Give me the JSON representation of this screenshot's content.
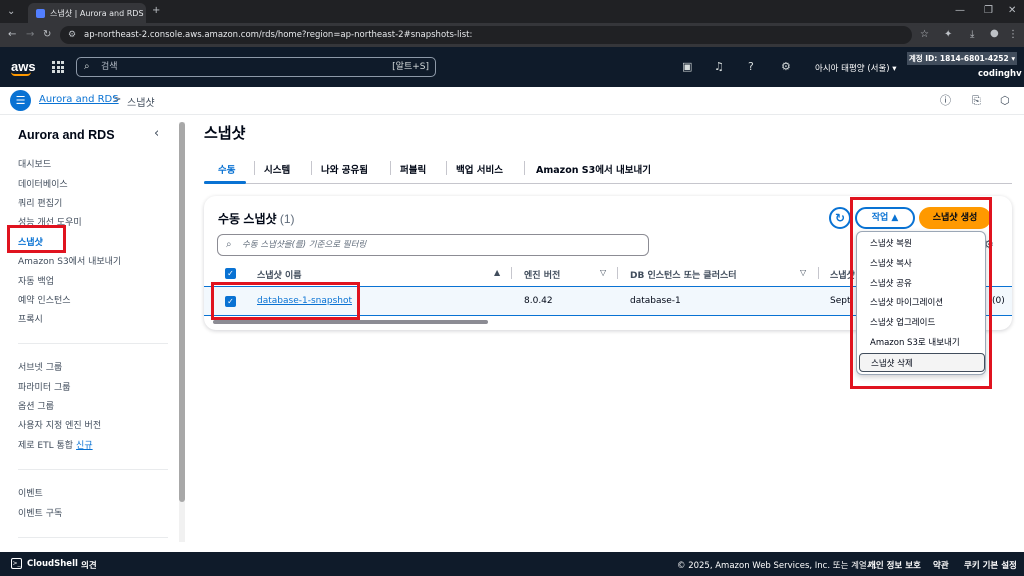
{
  "browser": {
    "tab_title": "스냅샷 | Aurora and RDS | ap-",
    "tab_close": "×",
    "new_tab": "+",
    "url": "ap-northeast-2.console.aws.amazon.com/rds/home?region=ap-northeast-2#snapshots-list:"
  },
  "aws_nav": {
    "logo": "aws",
    "search_placeholder": "검색",
    "search_shortcut": "[알트+S]",
    "region": "아시아 태평양 (서울) ▾",
    "account": "계정 ID: 1814-6801-4252 ▾",
    "user": "codinghv"
  },
  "breadcrumb": {
    "root": "Aurora and RDS",
    "separator": ">",
    "current": "스냅샷"
  },
  "sidebar": {
    "title": "Aurora and RDS",
    "collapse": "‹",
    "items": [
      {
        "label": "대시보드"
      },
      {
        "label": "데이터베이스"
      },
      {
        "label": "쿼리 편집기"
      },
      {
        "label": "성능 개선 도우미"
      },
      {
        "label": "스냅샷"
      },
      {
        "label": "Amazon S3에서 내보내기"
      },
      {
        "label": "자동 백업"
      },
      {
        "label": "예약 인스턴스"
      },
      {
        "label": "프록시"
      }
    ],
    "group2": [
      {
        "label": "서브넷 그룹"
      },
      {
        "label": "파라미터 그룹"
      },
      {
        "label": "옵션 그룹"
      },
      {
        "label": "사용자 지정 엔진 버전"
      },
      {
        "label": "제로 ETL 통합",
        "badge": "신규"
      }
    ],
    "group3": [
      {
        "label": "이벤트"
      },
      {
        "label": "이벤트 구독"
      }
    ]
  },
  "main": {
    "title": "스냅샷",
    "tabs": [
      {
        "label": "수동"
      },
      {
        "label": "시스템"
      },
      {
        "label": "나와 공유됨"
      },
      {
        "label": "퍼블릭"
      },
      {
        "label": "백업 서비스"
      },
      {
        "label": "Amazon S3에서 내보내기"
      }
    ]
  },
  "panel": {
    "title": "수동 스냅샷",
    "count": "(1)",
    "refresh": "↻",
    "actions_label": "작업 ▲",
    "create_label": "스냅샷 생성",
    "filter_placeholder": "수동 스냅샷을(를) 기준으로 필터링",
    "columns": [
      {
        "label": "스냅샷 이름",
        "sort": "▲"
      },
      {
        "label": "엔진 버전",
        "sort": "▽"
      },
      {
        "label": "DB 인스턴스 또는 클러스터",
        "sort": "▽"
      },
      {
        "label": "스냅샷",
        "sort": ""
      }
    ],
    "rows": [
      {
        "name": "database-1-snapshot",
        "engine_version": "8.0.42",
        "instance": "database-1",
        "created": "Sept",
        "tail": "(0)"
      }
    ]
  },
  "actions_menu": {
    "items": [
      {
        "label": "스냅샷 복원"
      },
      {
        "label": "스냅샷 복사"
      },
      {
        "label": "스냅샷 공유"
      },
      {
        "label": "스냅샷 마이그레이션"
      },
      {
        "label": "스냅샷 업그레이드"
      },
      {
        "label": "Amazon S3로 내보내기"
      },
      {
        "label": "스냅샷 삭제"
      }
    ]
  },
  "footer": {
    "cloudshell": "CloudShell",
    "feedback": "의견",
    "copyright": "© 2025, Amazon Web Services, Inc. 또는 계열사.",
    "privacy": "개인 정보 보호",
    "terms": "약관",
    "cookies": "쿠키 기본 설정"
  },
  "colors": {
    "accent": "#0972d3",
    "primary_button": "#ff9900",
    "nav_bg": "#0f1b2a",
    "annotation": "#e0131f"
  }
}
